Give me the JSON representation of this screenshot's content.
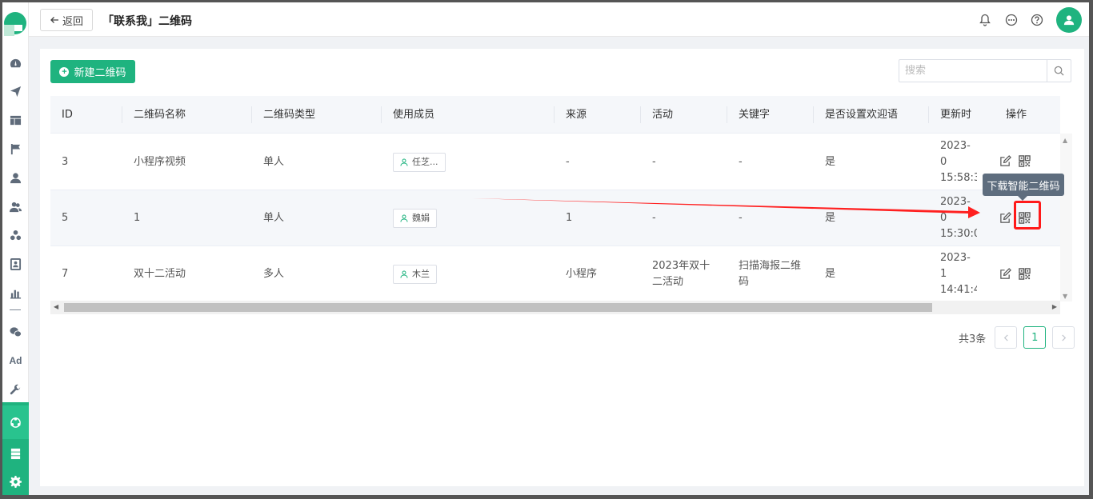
{
  "header": {
    "back_label": "返回",
    "title": "「联系我」二维码"
  },
  "sidebar": {
    "items": [
      {
        "icon": "dashboard-icon"
      },
      {
        "icon": "send-icon"
      },
      {
        "icon": "layout-icon"
      },
      {
        "icon": "flag-icon"
      },
      {
        "icon": "user-icon"
      },
      {
        "icon": "users-icon"
      },
      {
        "icon": "group-icon"
      },
      {
        "icon": "contact-card-icon"
      },
      {
        "icon": "bar-chart-icon"
      },
      {
        "icon": "wechat-icon"
      },
      {
        "icon": "ad-icon",
        "text": "Ad"
      },
      {
        "icon": "wrench-icon"
      },
      {
        "icon": "network-icon",
        "active": true
      },
      {
        "icon": "server-icon"
      },
      {
        "icon": "gear-icon"
      }
    ]
  },
  "toolbar": {
    "new_button": "新建二维码",
    "search_placeholder": "搜索"
  },
  "table": {
    "columns": [
      "ID",
      "二维码名称",
      "二维码类型",
      "使用成员",
      "来源",
      "活动",
      "关键字",
      "是否设置欢迎语",
      "更新时间",
      "操作"
    ],
    "columns_visible": [
      "ID",
      "二维码名称",
      "二维码类型",
      "使用成员",
      "来源",
      "活动",
      "关键字",
      "是否设置欢迎语",
      "更新时",
      "操作"
    ],
    "rows": [
      {
        "id": "3",
        "name": "小程序视频",
        "type": "单人",
        "member": "任芝...",
        "source": "-",
        "activity": "-",
        "keyword": "-",
        "welcome": "是",
        "updated_1": "2023-0",
        "updated_2": "15:58:3"
      },
      {
        "id": "5",
        "name": "1",
        "type": "单人",
        "member": "魏娟",
        "source": "1",
        "activity": "-",
        "keyword": "-",
        "welcome": "是",
        "updated_1": "2023-0",
        "updated_2": "15:30:0"
      },
      {
        "id": "7",
        "name": "双十二活动",
        "type": "多人",
        "member": "木兰",
        "source": "小程序",
        "activity": "2023年双十二活动",
        "keyword": "扫描海报二维码",
        "welcome": "是",
        "updated_1": "2023-1",
        "updated_2": "14:41:4"
      }
    ]
  },
  "tooltip": "下载智能二维码",
  "pagination": {
    "total": "共3条",
    "current": "1"
  },
  "colors": {
    "brand": "#1fb37f",
    "highlight": "#ff1a1a",
    "tooltip_bg": "#5e6d7e"
  }
}
